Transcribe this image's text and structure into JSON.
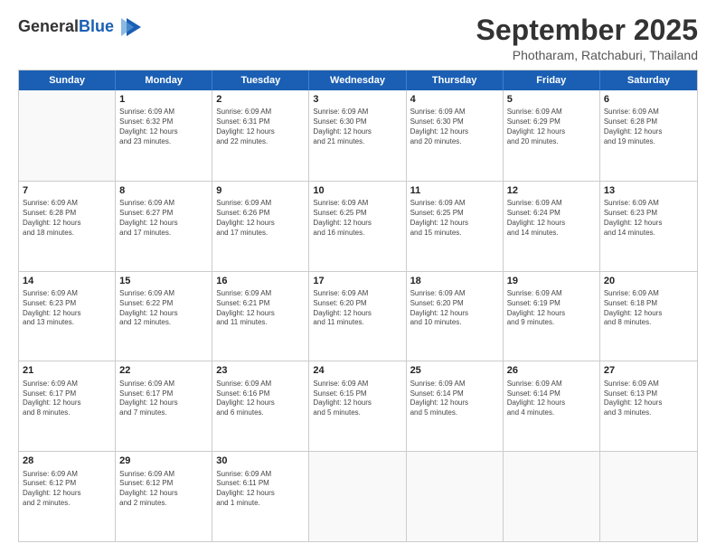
{
  "header": {
    "logo_general": "General",
    "logo_blue": "Blue",
    "month": "September 2025",
    "location": "Photharam, Ratchaburi, Thailand"
  },
  "weekdays": [
    "Sunday",
    "Monday",
    "Tuesday",
    "Wednesday",
    "Thursday",
    "Friday",
    "Saturday"
  ],
  "weeks": [
    [
      {
        "day": "",
        "info": ""
      },
      {
        "day": "1",
        "info": "Sunrise: 6:09 AM\nSunset: 6:32 PM\nDaylight: 12 hours\nand 23 minutes."
      },
      {
        "day": "2",
        "info": "Sunrise: 6:09 AM\nSunset: 6:31 PM\nDaylight: 12 hours\nand 22 minutes."
      },
      {
        "day": "3",
        "info": "Sunrise: 6:09 AM\nSunset: 6:30 PM\nDaylight: 12 hours\nand 21 minutes."
      },
      {
        "day": "4",
        "info": "Sunrise: 6:09 AM\nSunset: 6:30 PM\nDaylight: 12 hours\nand 20 minutes."
      },
      {
        "day": "5",
        "info": "Sunrise: 6:09 AM\nSunset: 6:29 PM\nDaylight: 12 hours\nand 20 minutes."
      },
      {
        "day": "6",
        "info": "Sunrise: 6:09 AM\nSunset: 6:28 PM\nDaylight: 12 hours\nand 19 minutes."
      }
    ],
    [
      {
        "day": "7",
        "info": "Sunrise: 6:09 AM\nSunset: 6:28 PM\nDaylight: 12 hours\nand 18 minutes."
      },
      {
        "day": "8",
        "info": "Sunrise: 6:09 AM\nSunset: 6:27 PM\nDaylight: 12 hours\nand 17 minutes."
      },
      {
        "day": "9",
        "info": "Sunrise: 6:09 AM\nSunset: 6:26 PM\nDaylight: 12 hours\nand 17 minutes."
      },
      {
        "day": "10",
        "info": "Sunrise: 6:09 AM\nSunset: 6:25 PM\nDaylight: 12 hours\nand 16 minutes."
      },
      {
        "day": "11",
        "info": "Sunrise: 6:09 AM\nSunset: 6:25 PM\nDaylight: 12 hours\nand 15 minutes."
      },
      {
        "day": "12",
        "info": "Sunrise: 6:09 AM\nSunset: 6:24 PM\nDaylight: 12 hours\nand 14 minutes."
      },
      {
        "day": "13",
        "info": "Sunrise: 6:09 AM\nSunset: 6:23 PM\nDaylight: 12 hours\nand 14 minutes."
      }
    ],
    [
      {
        "day": "14",
        "info": "Sunrise: 6:09 AM\nSunset: 6:23 PM\nDaylight: 12 hours\nand 13 minutes."
      },
      {
        "day": "15",
        "info": "Sunrise: 6:09 AM\nSunset: 6:22 PM\nDaylight: 12 hours\nand 12 minutes."
      },
      {
        "day": "16",
        "info": "Sunrise: 6:09 AM\nSunset: 6:21 PM\nDaylight: 12 hours\nand 11 minutes."
      },
      {
        "day": "17",
        "info": "Sunrise: 6:09 AM\nSunset: 6:20 PM\nDaylight: 12 hours\nand 11 minutes."
      },
      {
        "day": "18",
        "info": "Sunrise: 6:09 AM\nSunset: 6:20 PM\nDaylight: 12 hours\nand 10 minutes."
      },
      {
        "day": "19",
        "info": "Sunrise: 6:09 AM\nSunset: 6:19 PM\nDaylight: 12 hours\nand 9 minutes."
      },
      {
        "day": "20",
        "info": "Sunrise: 6:09 AM\nSunset: 6:18 PM\nDaylight: 12 hours\nand 8 minutes."
      }
    ],
    [
      {
        "day": "21",
        "info": "Sunrise: 6:09 AM\nSunset: 6:17 PM\nDaylight: 12 hours\nand 8 minutes."
      },
      {
        "day": "22",
        "info": "Sunrise: 6:09 AM\nSunset: 6:17 PM\nDaylight: 12 hours\nand 7 minutes."
      },
      {
        "day": "23",
        "info": "Sunrise: 6:09 AM\nSunset: 6:16 PM\nDaylight: 12 hours\nand 6 minutes."
      },
      {
        "day": "24",
        "info": "Sunrise: 6:09 AM\nSunset: 6:15 PM\nDaylight: 12 hours\nand 5 minutes."
      },
      {
        "day": "25",
        "info": "Sunrise: 6:09 AM\nSunset: 6:14 PM\nDaylight: 12 hours\nand 5 minutes."
      },
      {
        "day": "26",
        "info": "Sunrise: 6:09 AM\nSunset: 6:14 PM\nDaylight: 12 hours\nand 4 minutes."
      },
      {
        "day": "27",
        "info": "Sunrise: 6:09 AM\nSunset: 6:13 PM\nDaylight: 12 hours\nand 3 minutes."
      }
    ],
    [
      {
        "day": "28",
        "info": "Sunrise: 6:09 AM\nSunset: 6:12 PM\nDaylight: 12 hours\nand 2 minutes."
      },
      {
        "day": "29",
        "info": "Sunrise: 6:09 AM\nSunset: 6:12 PM\nDaylight: 12 hours\nand 2 minutes."
      },
      {
        "day": "30",
        "info": "Sunrise: 6:09 AM\nSunset: 6:11 PM\nDaylight: 12 hours\nand 1 minute."
      },
      {
        "day": "",
        "info": ""
      },
      {
        "day": "",
        "info": ""
      },
      {
        "day": "",
        "info": ""
      },
      {
        "day": "",
        "info": ""
      }
    ]
  ]
}
